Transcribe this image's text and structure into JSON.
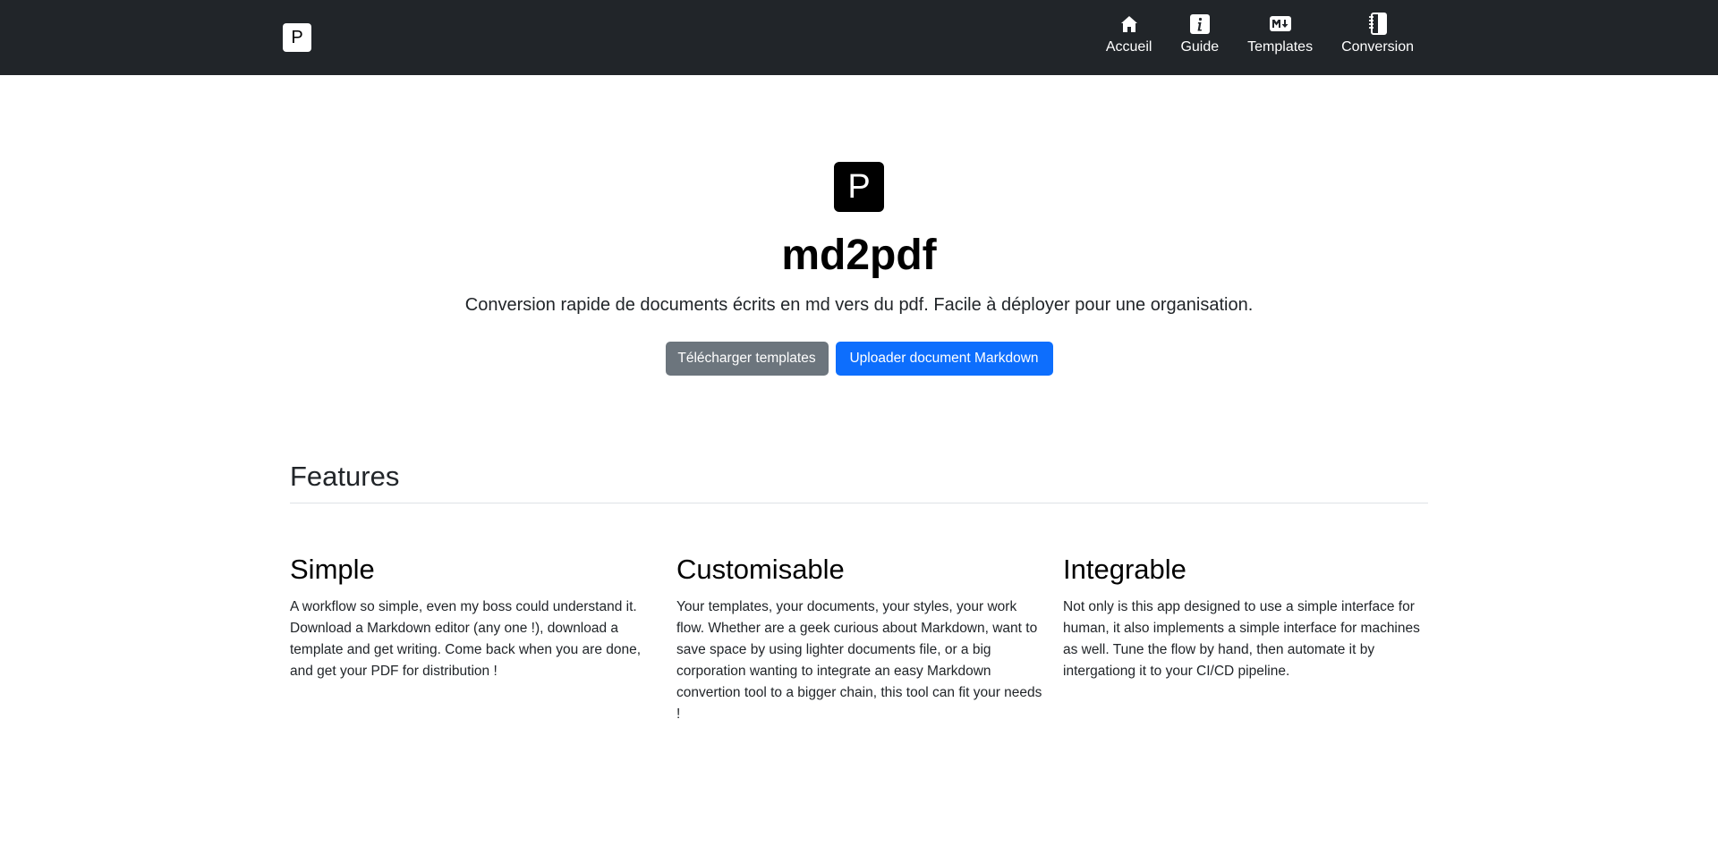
{
  "navbar": {
    "brand_letter": "P",
    "items": [
      {
        "label": "Accueil",
        "icon": "home-icon"
      },
      {
        "label": "Guide",
        "icon": "info-icon"
      },
      {
        "label": "Templates",
        "icon": "markdown-icon"
      },
      {
        "label": "Conversion",
        "icon": "notebook-icon"
      }
    ]
  },
  "hero": {
    "logo_letter": "P",
    "title": "md2pdf",
    "subtitle": "Conversion rapide de documents écrits en md vers du pdf. Facile à déployer pour une organisation.",
    "buttons": {
      "download_templates": "Télécharger templates",
      "upload_markdown": "Uploader document Markdown"
    }
  },
  "features": {
    "title": "Features",
    "items": [
      {
        "title": "Simple",
        "text": "A workflow so simple, even my boss could understand it. Download a Markdown editor (any one !), download a template and get writing. Come back when you are done, and get your PDF for distribution !"
      },
      {
        "title": "Customisable",
        "text": "Your templates, your documents, your styles, your work flow. Whether are a geek curious about Markdown, want to save space by using lighter documents file, or a big corporation wanting to integrate an easy Markdown convertion tool to a bigger chain, this tool can fit your needs !"
      },
      {
        "title": "Integrable",
        "text": "Not only is this app designed to use a simple interface for human, it also implements a simple interface for machines as well. Tune the flow by hand, then automate it by intergationg it to your CI/CD pipeline."
      }
    ]
  },
  "colors": {
    "navbar_bg": "#212529",
    "primary": "#0d6efd",
    "secondary": "#6c757d"
  }
}
